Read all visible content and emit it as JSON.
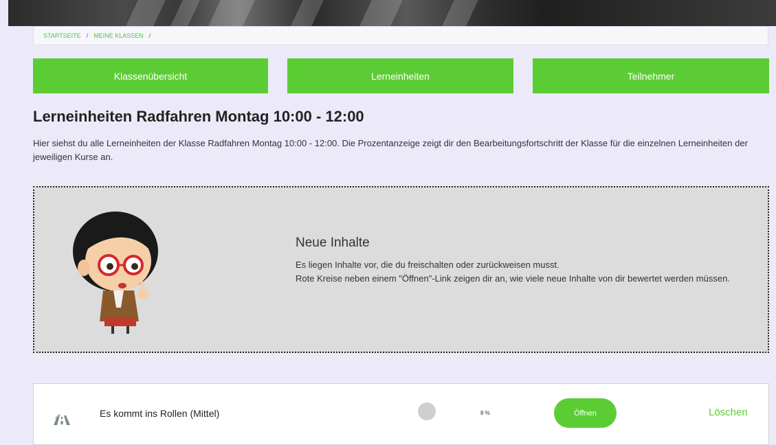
{
  "breadcrumb": {
    "items": [
      "STARTSEITE",
      "MEINE KLASSEN"
    ],
    "separator": "/"
  },
  "tabs": [
    {
      "label": "Klassenübersicht"
    },
    {
      "label": "Lerneinheiten"
    },
    {
      "label": "Teilnehmer"
    }
  ],
  "page": {
    "title": "Lerneinheiten Radfahren Montag 10:00 - 12:00",
    "intro": "Hier siehst du alle Lerneinheiten der Klasse Radfahren Montag 10:00 - 12:00. Die Prozentanzeige zeigt dir den Bearbeitungsfortschritt der Klasse für die einzelnen Lerneinheiten der jeweiligen Kurse an."
  },
  "notice": {
    "title": "Neue Inhalte",
    "line1": "Es liegen Inhalte vor, die du freischalten oder zurückweisen musst.",
    "line2": "Rote Kreise neben einem \"Öffnen\"-Link zeigen dir an, wie viele neue Inhalte von dir bewertet werden müssen.",
    "avatar_icon": "teacher-avatar-illustration"
  },
  "units": [
    {
      "title": "Es kommt ins Rollen (Mittel)",
      "icon": "road-icon",
      "progress_percent": 8,
      "progress_label": "8 %",
      "open_label": "Öffnen",
      "delete_label": "Löschen"
    }
  ],
  "colors": {
    "accent_green": "#5ccc35",
    "page_bg": "#eceaf8",
    "notice_bg": "#dcdcdc"
  }
}
